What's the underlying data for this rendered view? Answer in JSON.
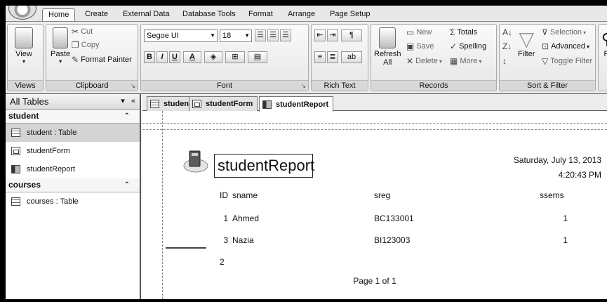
{
  "tabs": [
    "Home",
    "Create",
    "External Data",
    "Database Tools",
    "Format",
    "Arrange",
    "Page Setup"
  ],
  "ribbon": {
    "views": {
      "label": "Views",
      "view_btn": "View"
    },
    "clipboard": {
      "label": "Clipboard",
      "paste": "Paste",
      "cut": "Cut",
      "copy": "Copy",
      "format_painter": "Format Painter"
    },
    "font": {
      "label": "Font",
      "family": "Segoe UI",
      "size": "18",
      "bold": "B",
      "italic": "I",
      "underline": "U",
      "font_color": "A"
    },
    "rich_text": {
      "label": "Rich Text"
    },
    "records": {
      "label": "Records",
      "refresh": "Refresh",
      "refresh_sub": "All",
      "new": "New",
      "save": "Save",
      "delete": "Delete",
      "totals": "Totals",
      "spelling": "Spelling",
      "more": "More"
    },
    "sort_filter": {
      "label": "Sort & Filter",
      "filter": "Filter",
      "selection": "Selection",
      "advanced": "Advanced",
      "toggle_filter": "Toggle Filter"
    },
    "find": {
      "partial": "Fi"
    }
  },
  "nav": {
    "title": "All Tables",
    "groups": [
      {
        "name": "student",
        "items": [
          {
            "label": "student : Table",
            "type": "table"
          },
          {
            "label": "studentForm",
            "type": "form"
          },
          {
            "label": "studentReport",
            "type": "report"
          }
        ]
      },
      {
        "name": "courses",
        "items": [
          {
            "label": "courses : Table",
            "type": "table"
          }
        ]
      }
    ]
  },
  "doc_tabs": [
    {
      "label": "student",
      "type": "table"
    },
    {
      "label": "studentForm",
      "type": "form"
    },
    {
      "label": "studentReport",
      "type": "report"
    }
  ],
  "report": {
    "title": "studentReport",
    "date": "Saturday, July 13, 2013",
    "time": "4:20:43 PM",
    "columns": [
      "ID",
      "sname",
      "sreg",
      "ssems"
    ],
    "rows": [
      {
        "id": "1",
        "sname": "Ahmed",
        "sreg": "BC133001",
        "ssems": "1"
      },
      {
        "id": "3",
        "sname": "Nazia",
        "sreg": "BI123003",
        "ssems": "1"
      }
    ],
    "count": "2",
    "page_text": "Page 1 of 1"
  }
}
